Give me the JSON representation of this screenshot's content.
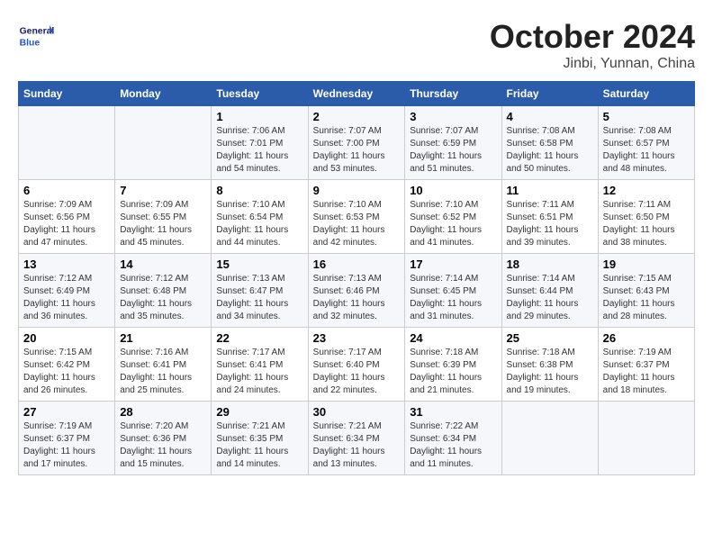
{
  "header": {
    "logo_general": "General",
    "logo_blue": "Blue",
    "month_title": "October 2024",
    "location": "Jinbi, Yunnan, China"
  },
  "weekdays": [
    "Sunday",
    "Monday",
    "Tuesday",
    "Wednesday",
    "Thursday",
    "Friday",
    "Saturday"
  ],
  "weeks": [
    [
      {
        "day": "",
        "info": ""
      },
      {
        "day": "",
        "info": ""
      },
      {
        "day": "1",
        "info": "Sunrise: 7:06 AM\nSunset: 7:01 PM\nDaylight: 11 hours and 54 minutes."
      },
      {
        "day": "2",
        "info": "Sunrise: 7:07 AM\nSunset: 7:00 PM\nDaylight: 11 hours and 53 minutes."
      },
      {
        "day": "3",
        "info": "Sunrise: 7:07 AM\nSunset: 6:59 PM\nDaylight: 11 hours and 51 minutes."
      },
      {
        "day": "4",
        "info": "Sunrise: 7:08 AM\nSunset: 6:58 PM\nDaylight: 11 hours and 50 minutes."
      },
      {
        "day": "5",
        "info": "Sunrise: 7:08 AM\nSunset: 6:57 PM\nDaylight: 11 hours and 48 minutes."
      }
    ],
    [
      {
        "day": "6",
        "info": "Sunrise: 7:09 AM\nSunset: 6:56 PM\nDaylight: 11 hours and 47 minutes."
      },
      {
        "day": "7",
        "info": "Sunrise: 7:09 AM\nSunset: 6:55 PM\nDaylight: 11 hours and 45 minutes."
      },
      {
        "day": "8",
        "info": "Sunrise: 7:10 AM\nSunset: 6:54 PM\nDaylight: 11 hours and 44 minutes."
      },
      {
        "day": "9",
        "info": "Sunrise: 7:10 AM\nSunset: 6:53 PM\nDaylight: 11 hours and 42 minutes."
      },
      {
        "day": "10",
        "info": "Sunrise: 7:10 AM\nSunset: 6:52 PM\nDaylight: 11 hours and 41 minutes."
      },
      {
        "day": "11",
        "info": "Sunrise: 7:11 AM\nSunset: 6:51 PM\nDaylight: 11 hours and 39 minutes."
      },
      {
        "day": "12",
        "info": "Sunrise: 7:11 AM\nSunset: 6:50 PM\nDaylight: 11 hours and 38 minutes."
      }
    ],
    [
      {
        "day": "13",
        "info": "Sunrise: 7:12 AM\nSunset: 6:49 PM\nDaylight: 11 hours and 36 minutes."
      },
      {
        "day": "14",
        "info": "Sunrise: 7:12 AM\nSunset: 6:48 PM\nDaylight: 11 hours and 35 minutes."
      },
      {
        "day": "15",
        "info": "Sunrise: 7:13 AM\nSunset: 6:47 PM\nDaylight: 11 hours and 34 minutes."
      },
      {
        "day": "16",
        "info": "Sunrise: 7:13 AM\nSunset: 6:46 PM\nDaylight: 11 hours and 32 minutes."
      },
      {
        "day": "17",
        "info": "Sunrise: 7:14 AM\nSunset: 6:45 PM\nDaylight: 11 hours and 31 minutes."
      },
      {
        "day": "18",
        "info": "Sunrise: 7:14 AM\nSunset: 6:44 PM\nDaylight: 11 hours and 29 minutes."
      },
      {
        "day": "19",
        "info": "Sunrise: 7:15 AM\nSunset: 6:43 PM\nDaylight: 11 hours and 28 minutes."
      }
    ],
    [
      {
        "day": "20",
        "info": "Sunrise: 7:15 AM\nSunset: 6:42 PM\nDaylight: 11 hours and 26 minutes."
      },
      {
        "day": "21",
        "info": "Sunrise: 7:16 AM\nSunset: 6:41 PM\nDaylight: 11 hours and 25 minutes."
      },
      {
        "day": "22",
        "info": "Sunrise: 7:17 AM\nSunset: 6:41 PM\nDaylight: 11 hours and 24 minutes."
      },
      {
        "day": "23",
        "info": "Sunrise: 7:17 AM\nSunset: 6:40 PM\nDaylight: 11 hours and 22 minutes."
      },
      {
        "day": "24",
        "info": "Sunrise: 7:18 AM\nSunset: 6:39 PM\nDaylight: 11 hours and 21 minutes."
      },
      {
        "day": "25",
        "info": "Sunrise: 7:18 AM\nSunset: 6:38 PM\nDaylight: 11 hours and 19 minutes."
      },
      {
        "day": "26",
        "info": "Sunrise: 7:19 AM\nSunset: 6:37 PM\nDaylight: 11 hours and 18 minutes."
      }
    ],
    [
      {
        "day": "27",
        "info": "Sunrise: 7:19 AM\nSunset: 6:37 PM\nDaylight: 11 hours and 17 minutes."
      },
      {
        "day": "28",
        "info": "Sunrise: 7:20 AM\nSunset: 6:36 PM\nDaylight: 11 hours and 15 minutes."
      },
      {
        "day": "29",
        "info": "Sunrise: 7:21 AM\nSunset: 6:35 PM\nDaylight: 11 hours and 14 minutes."
      },
      {
        "day": "30",
        "info": "Sunrise: 7:21 AM\nSunset: 6:34 PM\nDaylight: 11 hours and 13 minutes."
      },
      {
        "day": "31",
        "info": "Sunrise: 7:22 AM\nSunset: 6:34 PM\nDaylight: 11 hours and 11 minutes."
      },
      {
        "day": "",
        "info": ""
      },
      {
        "day": "",
        "info": ""
      }
    ]
  ]
}
